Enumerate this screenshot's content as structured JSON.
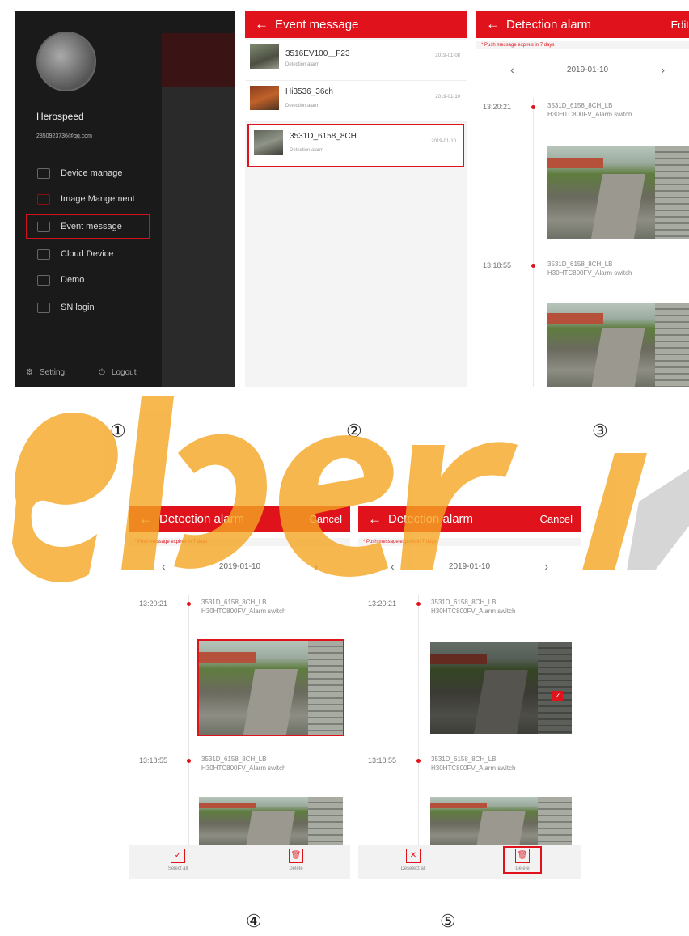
{
  "colors": {
    "accent": "#e0121b",
    "watermark_orange": "#f5a623",
    "watermark_gray": "#c8c8c8"
  },
  "screen1": {
    "user_name": "Herospeed",
    "user_email": "2850923736@qq.com",
    "menu": [
      {
        "label": "Device manage",
        "icon": "device-icon"
      },
      {
        "label": "Image Mangement",
        "icon": "image-icon"
      },
      {
        "label": "Event message",
        "icon": "message-icon"
      },
      {
        "label": "Cloud Device",
        "icon": "cloud-icon"
      },
      {
        "label": "Demo",
        "icon": "demo-icon"
      },
      {
        "label": "SN login",
        "icon": "sn-login-icon"
      }
    ],
    "setting_label": "Setting",
    "logout_label": "Logout"
  },
  "screen2": {
    "title": "Event message",
    "events": [
      {
        "name": "3516EV100＿F23",
        "type": "Detection alarm",
        "date": "2019-01-08"
      },
      {
        "name": "Hi3536_36ch",
        "type": "Detection alarm",
        "date": "2019-01-10"
      },
      {
        "name": "3531D_6158_8CH",
        "type": "Detection alarm",
        "date": "2019-01-10"
      }
    ]
  },
  "detection": {
    "title": "Detection alarm",
    "edit_label": "Edit",
    "cancel_label": "Cancel",
    "note": "* Push message expires in 7 days",
    "date": "2019-01-10",
    "prev": "‹",
    "next": "›",
    "entries": [
      {
        "time": "13:20:21",
        "name": "3531D_6158_8CH_LB H30HTC800FV_Alarm switch"
      },
      {
        "time": "13:18:55",
        "name": "3531D_6158_8CH_LB H30HTC800FV_Alarm switch"
      }
    ],
    "select_all": "Select all",
    "deselect_all": "Deselect all",
    "delete": "Delete"
  },
  "step_labels": [
    "①",
    "②",
    "③",
    "④",
    "⑤"
  ]
}
